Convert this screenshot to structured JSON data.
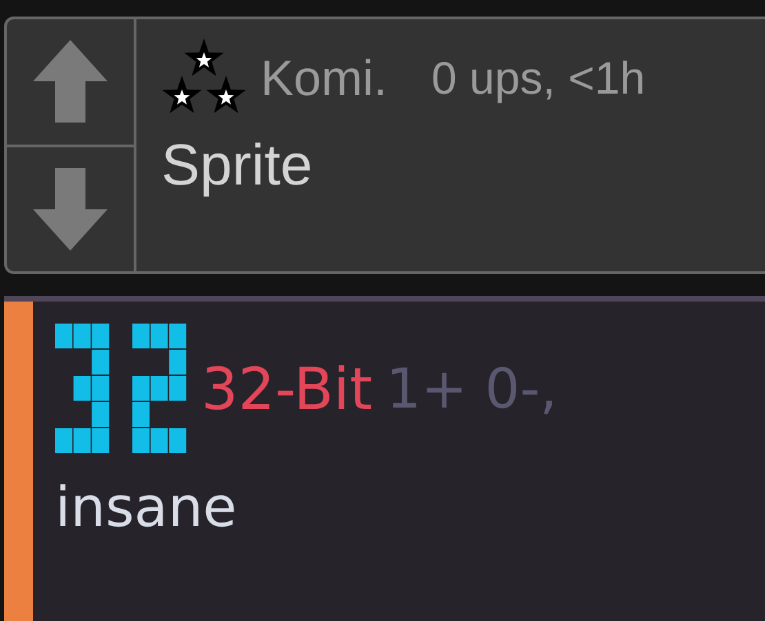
{
  "comments": [
    {
      "kind": "vote_card",
      "username": "Komi.",
      "meta": "0 ups, <1h",
      "body": "Sprite"
    },
    {
      "kind": "bar_card",
      "username": "32-Bit",
      "meta": "1+ 0-,",
      "body": "insane"
    }
  ]
}
